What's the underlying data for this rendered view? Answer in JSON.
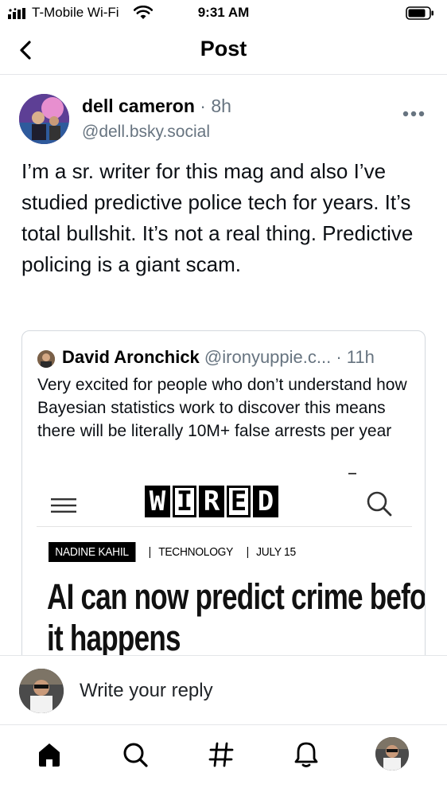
{
  "status_bar": {
    "carrier": "T-Mobile Wi-Fi",
    "time": "9:31 AM"
  },
  "header": {
    "title": "Post"
  },
  "post": {
    "author_name": "dell cameron",
    "time_ago": "8h",
    "handle": "@dell.bsky.social",
    "text": "I’m a sr. writer for this mag and also I’ve studied predictive police tech for years. It’s total bullshit. It’s not a real thing. Predictive policing is a giant scam."
  },
  "quote": {
    "author_name": "David Aronchick",
    "handle": "@ironyuppie.c...",
    "time_ago": "11h",
    "text": "Very excited for people who don’t understand how Bayesian statistics work to discover this means there will be literally 10M+ false arrests per year",
    "article": {
      "logo_letters": [
        "W",
        "I",
        "R",
        "E",
        "D"
      ],
      "author": "NADINE KAHIL",
      "section": "TECHNOLOGY",
      "date": "JULY 15",
      "headline_line1": "AI can now predict crime before",
      "headline_line2": "it happens"
    }
  },
  "reply": {
    "placeholder": "Write your reply"
  },
  "tabs": [
    "home-icon",
    "search-icon",
    "hashtag-icon",
    "notifications-icon",
    "profile-avatar"
  ],
  "colors": {
    "muted": "#677480",
    "divider": "#e4e6e9",
    "text": "#0b0f14"
  }
}
